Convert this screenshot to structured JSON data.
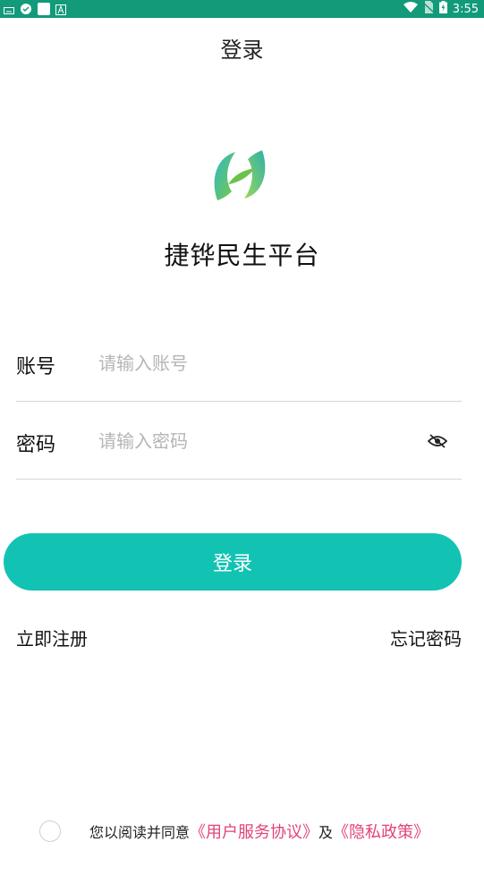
{
  "status_bar": {
    "time": "3:55"
  },
  "header": {
    "title": "登录"
  },
  "app": {
    "name": "捷铧民生平台"
  },
  "form": {
    "account": {
      "label": "账号",
      "placeholder": "请输入账号"
    },
    "password": {
      "label": "密码",
      "placeholder": "请输入密码"
    }
  },
  "login_button": {
    "label": "登录"
  },
  "links": {
    "register": "立即注册",
    "forgot": "忘记密码"
  },
  "agreement": {
    "text": "您以阅读并同意",
    "user_agreement": "《用户服务协议》",
    "conjunction": "及",
    "privacy_policy": "《隐私政策》"
  },
  "colors": {
    "accent": "#12c3b4",
    "status_bar": "#129a79",
    "link": "#e2437b"
  }
}
